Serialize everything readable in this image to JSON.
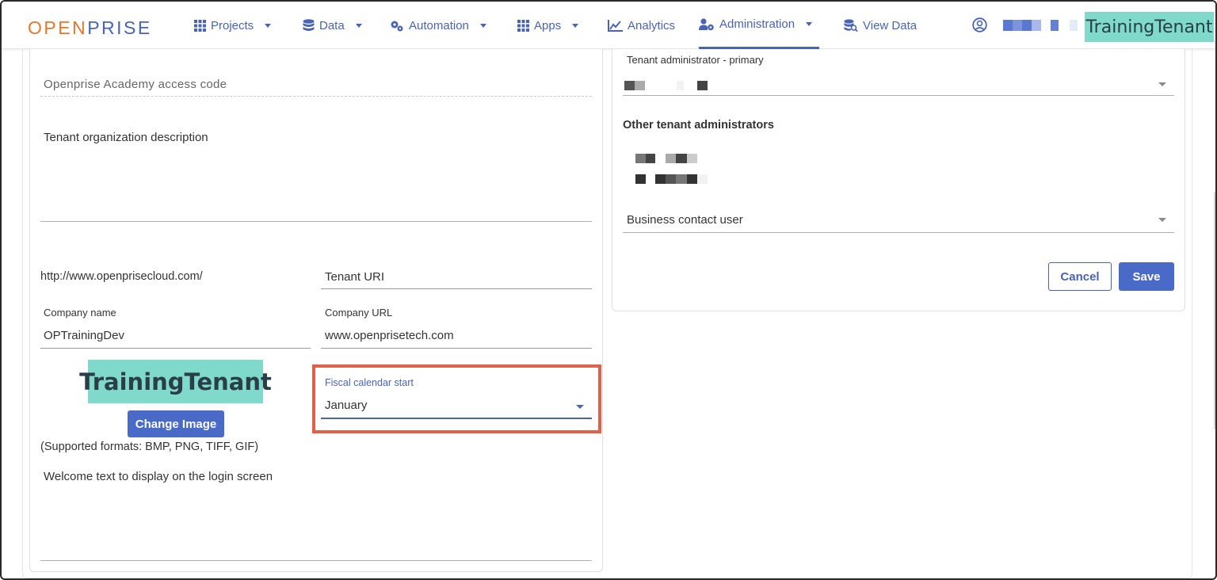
{
  "brand": {
    "logo_open": "OPEN",
    "logo_prise": "PRISE",
    "tenant_badge": "TrainingTenant"
  },
  "nav": {
    "projects": "Projects",
    "data": "Data",
    "automation": "Automation",
    "apps": "Apps",
    "analytics": "Analytics",
    "administration": "Administration",
    "view_data": "View Data"
  },
  "left": {
    "academy_code_placeholder": "Openprise Academy access code",
    "description_placeholder": "Tenant organization description",
    "uri_prefix": "http://www.openprisecloud.com/",
    "tenant_uri_placeholder": "Tenant URI",
    "company_name_label": "Company name",
    "company_name_value": "OPTrainingDev",
    "company_url_label": "Company URL",
    "company_url_value": "www.openprisetech.com",
    "logo_text": "TrainingTenant",
    "change_image_label": "Change Image",
    "supported_formats": "(Supported formats: BMP, PNG, TIFF, GIF)",
    "fiscal_label": "Fiscal calendar start",
    "fiscal_value": "January",
    "welcome_placeholder": "Welcome text to display on the login screen"
  },
  "right": {
    "primary_admin_label": "Tenant administrator - primary",
    "other_admins_heading": "Other tenant administrators",
    "business_contact_placeholder": "Business contact user",
    "cancel_label": "Cancel",
    "save_label": "Save"
  },
  "colors": {
    "accent": "#4a64b4",
    "brand_orange": "#e8772e",
    "tenant_teal": "#7fdacb",
    "highlight": "#e0604a"
  }
}
